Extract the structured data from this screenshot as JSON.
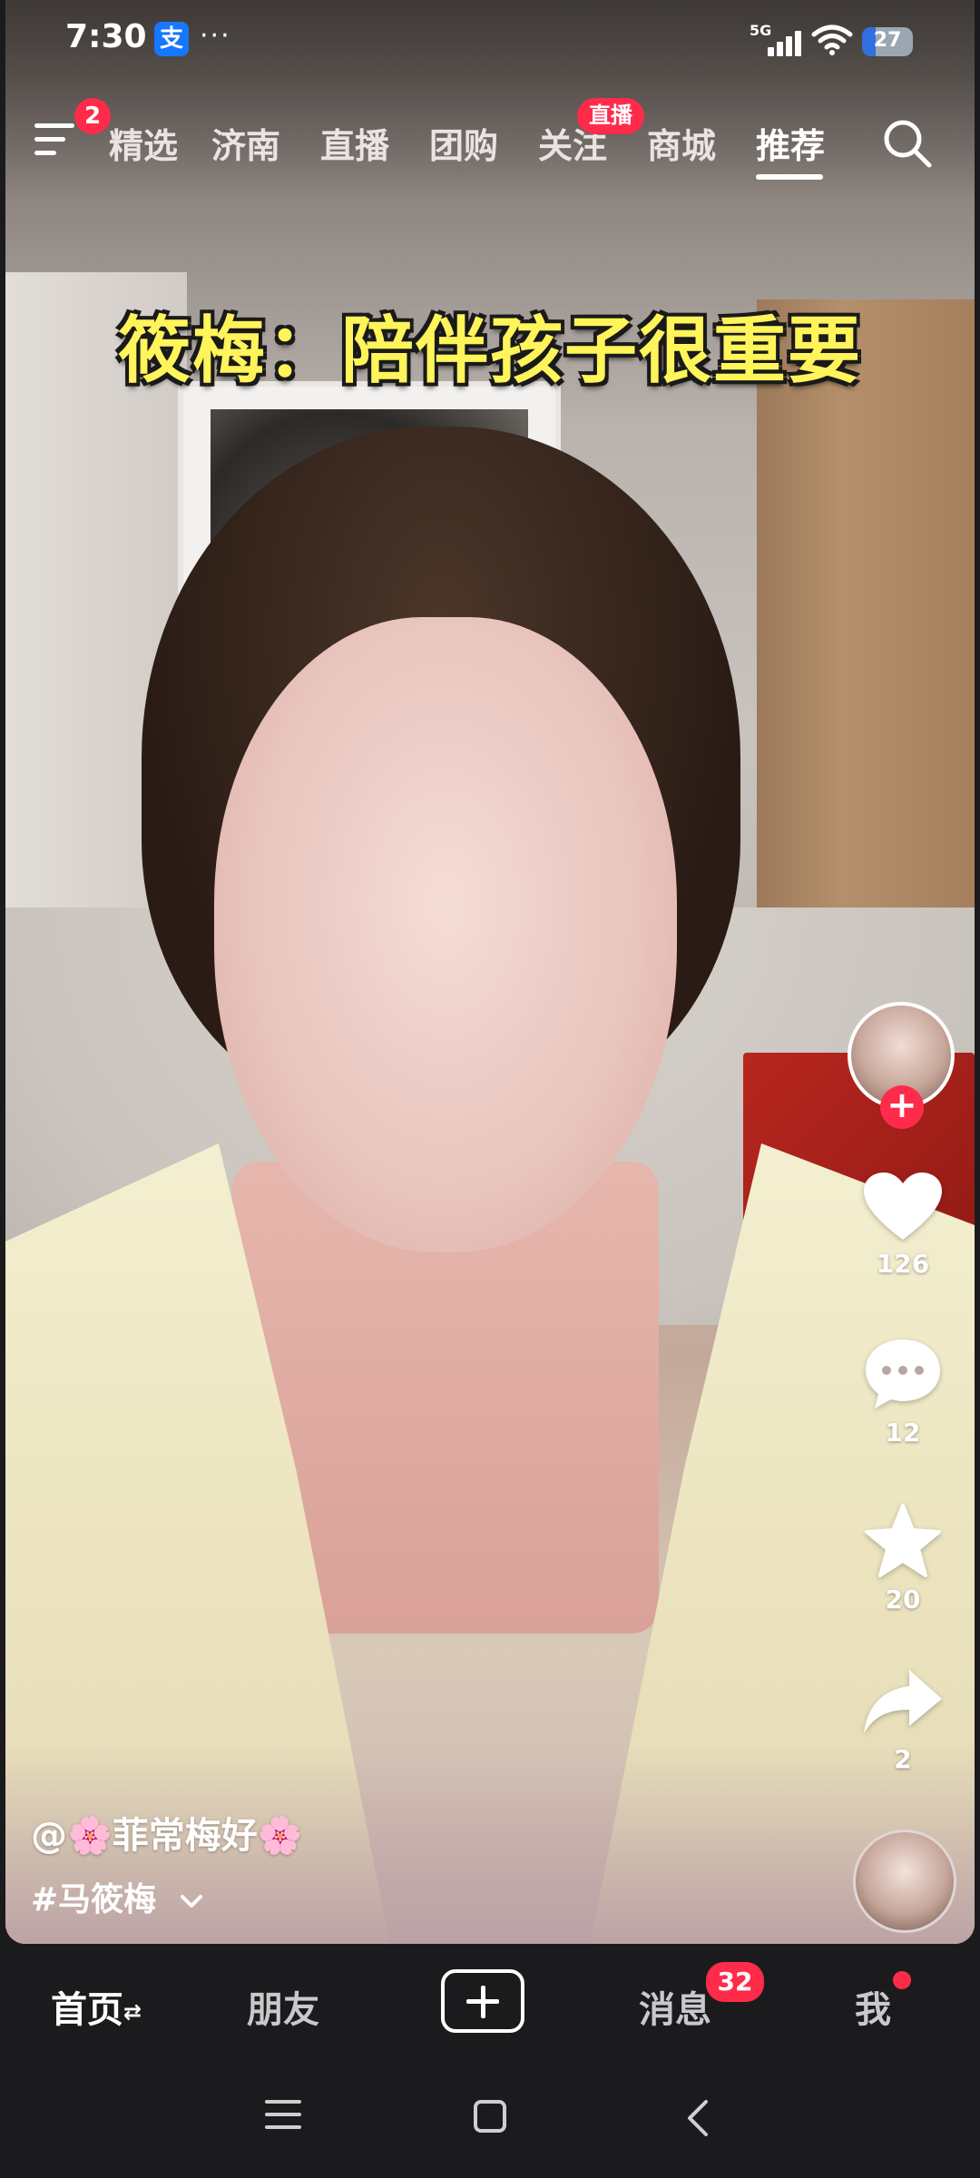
{
  "status_bar": {
    "time": "7:30",
    "alipay_glyph": "支",
    "more": "···",
    "network": "5G",
    "battery": "27",
    "battery_level": 0.27
  },
  "top_nav": {
    "menu_badge": "2",
    "tabs": [
      {
        "label": "精选"
      },
      {
        "label": "济南"
      },
      {
        "label": "直播"
      },
      {
        "label": "团购"
      },
      {
        "label": "关注"
      },
      {
        "label": "商城"
      },
      {
        "label": "推荐"
      }
    ],
    "live_badge": "直播",
    "active_tab": "推荐"
  },
  "video": {
    "caption": "筱梅：陪伴孩子很重要",
    "author": "@🌸菲常梅好🌸",
    "hashtag": "#马筱梅",
    "likes": "126",
    "comments": "12",
    "favorites": "20",
    "shares": "2",
    "follow_glyph": "+"
  },
  "bottom_tabs": {
    "home": "首页",
    "home_switch": "⇄",
    "friends": "朋友",
    "messages": "消息",
    "messages_badge": "32",
    "me": "我"
  },
  "colors": {
    "accent_red": "#ff2b4a",
    "caption_yellow": "#fff45a",
    "bar_bg": "#1b1b1d"
  },
  "icons": [
    "menu-icon",
    "search-icon",
    "heart-icon",
    "comment-icon",
    "star-icon",
    "share-icon",
    "plus-icon",
    "chevron-down-icon",
    "recent-apps-icon",
    "home-icon",
    "back-icon"
  ]
}
